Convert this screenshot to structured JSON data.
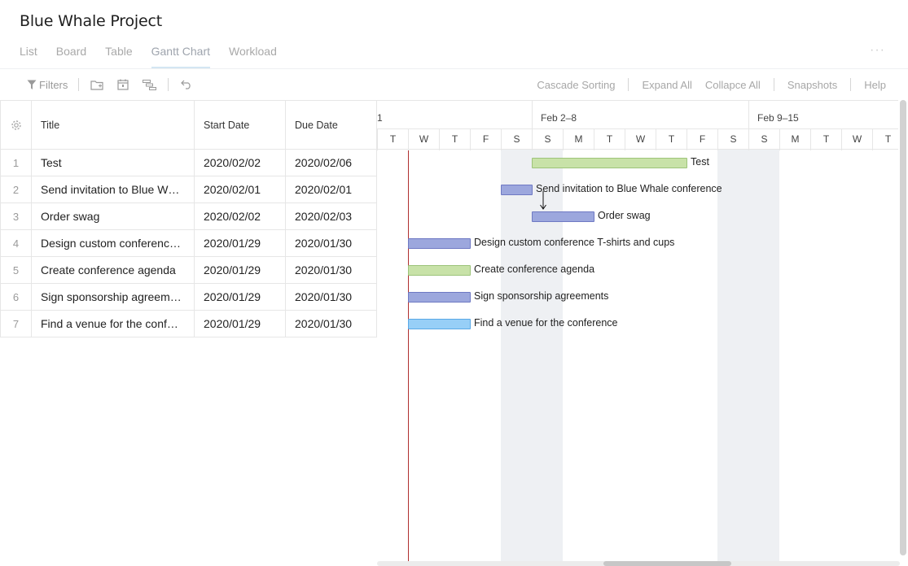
{
  "project": {
    "title": "Blue Whale Project"
  },
  "tabs": [
    {
      "label": "List"
    },
    {
      "label": "Board"
    },
    {
      "label": "Table"
    },
    {
      "label": "Gantt Chart",
      "active": true
    },
    {
      "label": "Workload"
    }
  ],
  "more_label": "···",
  "toolbar": {
    "filters_label": "Filters",
    "icons": [
      "folder-icon",
      "calendar-icon",
      "hierarchy-icon",
      "undo-icon"
    ],
    "right": [
      "Cascade Sorting",
      "Expand All",
      "Collapce All",
      "Snapshots",
      "Help"
    ]
  },
  "grid": {
    "headers": {
      "title": "Title",
      "start": "Start Date",
      "due": "Due Date"
    },
    "rows": [
      {
        "num": "1",
        "title": "Test",
        "start": "2020/02/02",
        "due": "2020/02/06"
      },
      {
        "num": "2",
        "title": "Send invitation to Blue W…",
        "start": "2020/02/01",
        "due": "2020/02/01"
      },
      {
        "num": "3",
        "title": "Order swag",
        "start": "2020/02/02",
        "due": "2020/02/03"
      },
      {
        "num": "4",
        "title": "Design custom conferenc…",
        "start": "2020/01/29",
        "due": "2020/01/30"
      },
      {
        "num": "5",
        "title": "Create conference agenda",
        "start": "2020/01/29",
        "due": "2020/01/30"
      },
      {
        "num": "6",
        "title": "Sign sponsorship agreem…",
        "start": "2020/01/29",
        "due": "2020/01/30"
      },
      {
        "num": "7",
        "title": "Find a venue for the conf…",
        "start": "2020/01/29",
        "due": "2020/01/30"
      }
    ]
  },
  "timeline": {
    "weeks": [
      "1",
      "Feb 2–8",
      "Feb 9–15"
    ],
    "days": [
      "T",
      "W",
      "T",
      "F",
      "S",
      "S",
      "M",
      "T",
      "W",
      "T",
      "F",
      "S",
      "S",
      "M",
      "T",
      "W",
      "T"
    ],
    "bars": [
      {
        "label": "Test",
        "color": "green"
      },
      {
        "label": "Send invitation to Blue Whale conference",
        "color": "blue"
      },
      {
        "label": "Order swag",
        "color": "blue"
      },
      {
        "label": "Design custom conference T-shirts and cups",
        "color": "blue"
      },
      {
        "label": "Create conference agenda",
        "color": "green"
      },
      {
        "label": "Sign sponsorship agreements",
        "color": "blue"
      },
      {
        "label": "Find a venue for the conference",
        "color": "sky"
      }
    ]
  },
  "colors": {
    "bar_blue": "#9ca7dd",
    "bar_green": "#c8e2a8",
    "bar_sky": "#97cff7",
    "today_line": "#b03030"
  }
}
